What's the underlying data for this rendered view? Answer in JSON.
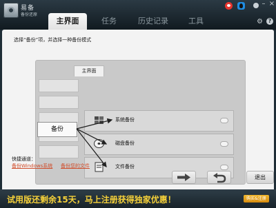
{
  "app": {
    "title": "易备",
    "subtitle": "备份还原"
  },
  "tabs": [
    {
      "label": "主界面",
      "active": true
    },
    {
      "label": "任务",
      "active": false
    },
    {
      "label": "历史记录",
      "active": false
    },
    {
      "label": "工具",
      "active": false
    }
  ],
  "main": {
    "instruction": "选择“备份”项，并选择一种备份模式",
    "illustration": {
      "tab_label": "主界面",
      "left_label": "备份",
      "options": [
        {
          "label": "系统备份",
          "icon": "windows-icon"
        },
        {
          "label": "磁盘备份",
          "icon": "disk-icon"
        },
        {
          "label": "文件备份",
          "icon": "file-icon"
        }
      ]
    },
    "quick": {
      "title": "快捷通道：",
      "links": [
        "备份Windows系统",
        "备份您的文件"
      ]
    },
    "buttons": {
      "exit_label": "退出"
    }
  },
  "banner": {
    "promo": "试用版还剩余15天，马上注册获得独家优惠！",
    "buy_label": "购买&注册"
  },
  "colors": {
    "accent": "#f6d13a",
    "link": "#d04d2b",
    "header": "#1f2d36"
  }
}
